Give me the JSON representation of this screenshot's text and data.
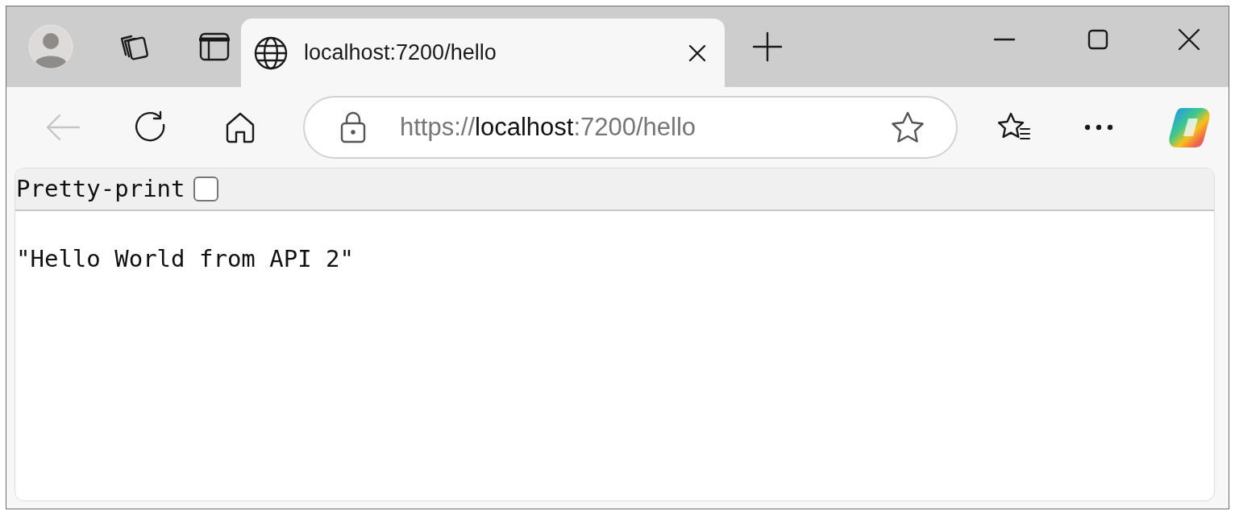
{
  "tab": {
    "title": "localhost:7200/hello",
    "selected": true
  },
  "address_bar": {
    "url_parts": [
      {
        "text": "https://",
        "highlighted": false
      },
      {
        "text": "localhost",
        "highlighted": true
      },
      {
        "text": ":7200/hello",
        "highlighted": false
      }
    ]
  },
  "back_button": {
    "disabled": true
  },
  "pretty_print": {
    "label": "Pretty-print",
    "checked": false
  },
  "body_text": "\"Hello World from API 2\""
}
